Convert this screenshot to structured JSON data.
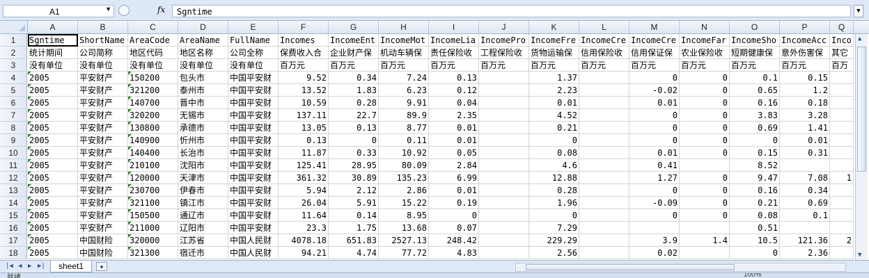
{
  "formula_bar": {
    "name_box": "A1",
    "fx_label": "fx",
    "formula_value": "Sgntime"
  },
  "columns": [
    "A",
    "B",
    "C",
    "D",
    "E",
    "F",
    "G",
    "H",
    "I",
    "J",
    "K",
    "L",
    "M",
    "N",
    "O",
    "P",
    "Q"
  ],
  "rows": [
    {
      "n": "1",
      "cells": [
        "Sgntime",
        "ShortName",
        "AreaCode",
        "AreaName",
        "FullName",
        "Incomes",
        "IncomeEnt",
        "IncomeMot",
        "IncomeLia",
        "IncomePro",
        "IncomeFre",
        "IncomeCre",
        "IncomeCre",
        "IncomeFar",
        "IncomeSho",
        "IncomeAcc",
        "Inco"
      ]
    },
    {
      "n": "2",
      "cells": [
        "统计期间",
        "公司简称",
        "地区代码",
        "地区名称",
        "公司全称",
        "保费收入合",
        "企业财产保",
        "机动车辆保",
        "责任保险收",
        "工程保险收",
        "货物运输保",
        "信用保险收",
        "信用保证保",
        "农业保险收",
        "短期健康保",
        "意外伤害保",
        "其它"
      ]
    },
    {
      "n": "3",
      "cells": [
        "没有单位",
        "没有单位",
        "没有单位",
        "没有单位",
        "没有单位",
        "百万元",
        "百万元",
        "百万元",
        "百万元",
        "百万元",
        "百万元",
        "百万元",
        "百万元",
        "百万元",
        "百万元",
        "百万元",
        "百万"
      ]
    },
    {
      "n": "4",
      "cells": [
        "2005",
        "平安财产",
        "150200",
        "包头市",
        "中国平安财",
        "9.52",
        "0.34",
        "7.24",
        "0.13",
        "",
        "1.37",
        "",
        "0",
        "0",
        "0.1",
        "0.15",
        ""
      ]
    },
    {
      "n": "5",
      "cells": [
        "2005",
        "平安财产",
        "321200",
        "泰州市",
        "中国平安财",
        "13.52",
        "1.83",
        "6.23",
        "0.12",
        "",
        "2.23",
        "",
        "-0.02",
        "0",
        "0.65",
        "1.2",
        ""
      ]
    },
    {
      "n": "6",
      "cells": [
        "2005",
        "平安财产",
        "140700",
        "晋中市",
        "中国平安财",
        "10.59",
        "0.28",
        "9.91",
        "0.04",
        "",
        "0.01",
        "",
        "0.01",
        "0",
        "0.16",
        "0.18",
        ""
      ]
    },
    {
      "n": "7",
      "cells": [
        "2005",
        "平安财产",
        "320200",
        "无锡市",
        "中国平安财",
        "137.11",
        "22.7",
        "89.9",
        "2.35",
        "",
        "4.52",
        "",
        "0",
        "0",
        "3.83",
        "3.28",
        ""
      ]
    },
    {
      "n": "8",
      "cells": [
        "2005",
        "平安财产",
        "130800",
        "承德市",
        "中国平安财",
        "13.05",
        "0.13",
        "8.77",
        "0.01",
        "",
        "0.21",
        "",
        "0",
        "0",
        "0.69",
        "1.41",
        ""
      ]
    },
    {
      "n": "9",
      "cells": [
        "2005",
        "平安财产",
        "140900",
        "忻州市",
        "中国平安财",
        "0.13",
        "0",
        "0.11",
        "0.01",
        "",
        "0",
        "",
        "0",
        "0",
        "0",
        "0.01",
        ""
      ]
    },
    {
      "n": "10",
      "cells": [
        "2005",
        "平安财产",
        "140400",
        "长治市",
        "中国平安财",
        "11.87",
        "0.33",
        "10.92",
        "0.05",
        "",
        "0.08",
        "",
        "0.01",
        "0",
        "0.15",
        "0.31",
        ""
      ]
    },
    {
      "n": "11",
      "cells": [
        "2005",
        "平安财产",
        "210100",
        "沈阳市",
        "中国平安财",
        "125.41",
        "28.95",
        "80.09",
        "2.84",
        "",
        "4.6",
        "",
        "0.41",
        "",
        "8.52",
        "",
        ""
      ]
    },
    {
      "n": "12",
      "cells": [
        "2005",
        "平安财产",
        "120000",
        "天津市",
        "中国平安财",
        "361.32",
        "30.89",
        "135.23",
        "6.99",
        "",
        "12.88",
        "",
        "1.27",
        "0",
        "9.47",
        "7.08",
        "1"
      ]
    },
    {
      "n": "13",
      "cells": [
        "2005",
        "平安财产",
        "230700",
        "伊春市",
        "中国平安财",
        "5.94",
        "2.12",
        "2.86",
        "0.01",
        "",
        "0.28",
        "",
        "0",
        "0",
        "0.16",
        "0.34",
        ""
      ]
    },
    {
      "n": "14",
      "cells": [
        "2005",
        "平安财产",
        "321100",
        "镇江市",
        "中国平安财",
        "26.04",
        "5.91",
        "15.22",
        "0.19",
        "",
        "1.96",
        "",
        "-0.09",
        "0",
        "0.21",
        "0.69",
        ""
      ]
    },
    {
      "n": "15",
      "cells": [
        "2005",
        "平安财产",
        "150500",
        "通辽市",
        "中国平安财",
        "11.64",
        "0.14",
        "8.95",
        "0",
        "",
        "0",
        "",
        "0",
        "0",
        "0.08",
        "0.1",
        ""
      ]
    },
    {
      "n": "16",
      "cells": [
        "2005",
        "平安财产",
        "211000",
        "辽阳市",
        "中国平安财",
        "23.3",
        "1.75",
        "13.68",
        "0.07",
        "",
        "7.29",
        "",
        "",
        "",
        "0.51",
        "",
        ""
      ]
    },
    {
      "n": "17",
      "cells": [
        "2005",
        "中国财险",
        "320000",
        "江苏省",
        "中国人民财",
        "4078.18",
        "651.83",
        "2527.13",
        "248.42",
        "",
        "229.29",
        "",
        "3.9",
        "1.4",
        "10.5",
        "121.36",
        "2"
      ]
    },
    {
      "n": "18",
      "cells": [
        "2005",
        "中国财险",
        "321300",
        "宿迁市",
        "中国人民财",
        "94.21",
        "4.74",
        "77.72",
        "4.83",
        "",
        "2.56",
        "",
        "0.02",
        "",
        "0",
        "2.36",
        ""
      ]
    }
  ],
  "sheet_tabs": [
    "sheet1"
  ],
  "status": {
    "text": "就绪",
    "zoom": "100%"
  }
}
